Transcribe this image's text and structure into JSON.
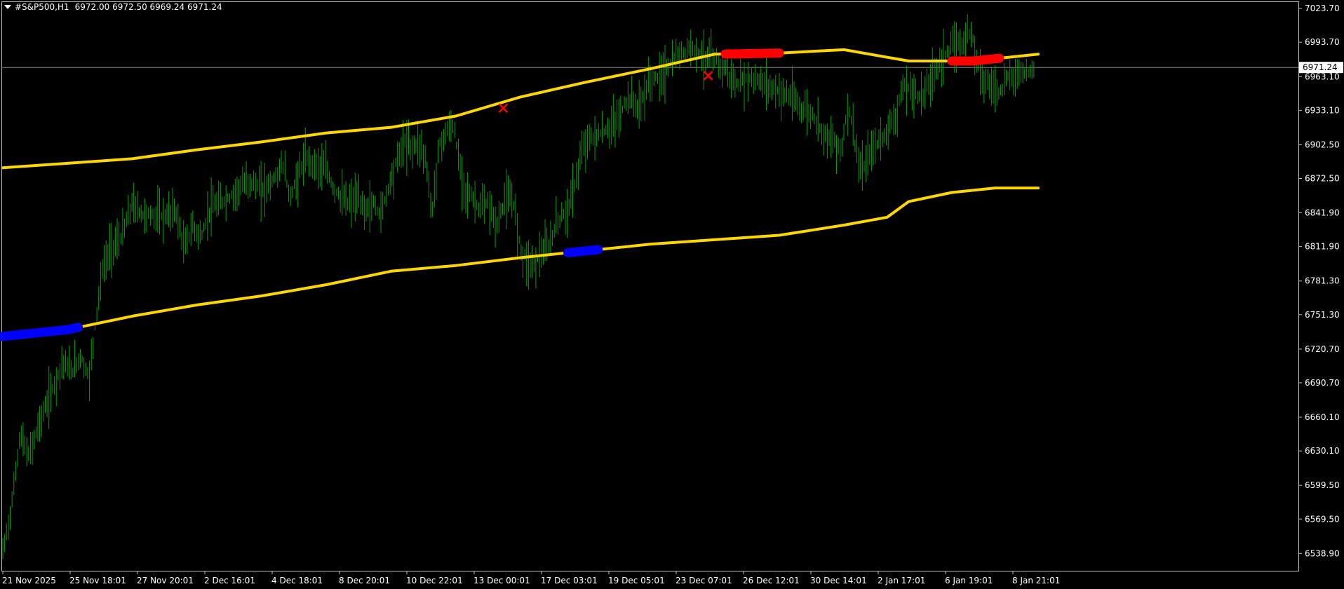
{
  "header": {
    "symbol_tf": "#S&P500,H1",
    "ohlc": "6972.00 6972.50 6969.24 6971.24"
  },
  "colors": {
    "background": "#000000",
    "grid_frame": "#c0c0c0",
    "candles": "#00a000",
    "band": "#ffd700",
    "signal_upper": "#ff0000",
    "signal_lower": "#0000ff",
    "price_line": "#808080",
    "label_text": "#ffffff",
    "current_price_box_bg": "#ffffff",
    "current_price_box_text": "#000000"
  },
  "chart_data": {
    "type": "line",
    "title": "#S&P500,H1",
    "ylim": [
      6523.5,
      7030.0
    ],
    "y_ticks": [
      "7023.70",
      "6993.70",
      "6963.10",
      "6933.10",
      "6902.50",
      "6872.50",
      "6841.90",
      "6811.90",
      "6781.30",
      "6751.30",
      "6720.70",
      "6690.70",
      "6660.10",
      "6630.10",
      "6599.50",
      "6569.50",
      "6538.90"
    ],
    "x_ticks": [
      "21 Nov 2025",
      "25 Nov 18:01",
      "27 Nov 20:01",
      "2 Dec 16:01",
      "4 Dec 18:01",
      "8 Dec 20:01",
      "10 Dec 22:01",
      "13 Dec 00:01",
      "17 Dec 03:01",
      "19 Dec 05:01",
      "23 Dec 07:01",
      "26 Dec 12:01",
      "30 Dec 14:01",
      "2 Jan 17:01",
      "6 Jan 19:01",
      "8 Jan 21:01"
    ],
    "current_price": "6971.24",
    "price_path": [
      [
        0,
        6540
      ],
      [
        0.4,
        6580
      ],
      [
        0.8,
        6645
      ],
      [
        1.2,
        6625
      ],
      [
        1.6,
        6650
      ],
      [
        2.0,
        6670
      ],
      [
        2.4,
        6690
      ],
      [
        2.8,
        6710
      ],
      [
        3.2,
        6700
      ],
      [
        3.6,
        6715
      ],
      [
        4.0,
        6695
      ],
      [
        4.3,
        6745
      ],
      [
        4.6,
        6790
      ],
      [
        5.0,
        6810
      ],
      [
        5.5,
        6820
      ],
      [
        6.0,
        6850
      ],
      [
        6.5,
        6840
      ],
      [
        7.0,
        6840
      ],
      [
        7.5,
        6838
      ],
      [
        8.0,
        6845
      ],
      [
        8.4,
        6810
      ],
      [
        8.8,
        6830
      ],
      [
        9.2,
        6820
      ],
      [
        9.6,
        6845
      ],
      [
        10.0,
        6850
      ],
      [
        10.5,
        6855
      ],
      [
        11.0,
        6865
      ],
      [
        11.5,
        6870
      ],
      [
        12.0,
        6862
      ],
      [
        12.5,
        6870
      ],
      [
        13.0,
        6885
      ],
      [
        13.3,
        6855
      ],
      [
        13.7,
        6875
      ],
      [
        14.0,
        6890
      ],
      [
        14.5,
        6885
      ],
      [
        15.0,
        6880
      ],
      [
        15.3,
        6865
      ],
      [
        15.7,
        6855
      ],
      [
        16.0,
        6850
      ],
      [
        16.4,
        6855
      ],
      [
        16.8,
        6845
      ],
      [
        17.2,
        6850
      ],
      [
        17.5,
        6840
      ],
      [
        17.8,
        6860
      ],
      [
        18.2,
        6885
      ],
      [
        18.6,
        6905
      ],
      [
        19.0,
        6900
      ],
      [
        19.3,
        6905
      ],
      [
        19.6,
        6890
      ],
      [
        19.9,
        6840
      ],
      [
        20.2,
        6900
      ],
      [
        20.6,
        6915
      ],
      [
        20.9,
        6920
      ],
      [
        21.2,
        6880
      ],
      [
        21.5,
        6860
      ],
      [
        21.8,
        6855
      ],
      [
        22.1,
        6845
      ],
      [
        22.5,
        6850
      ],
      [
        22.9,
        6830
      ],
      [
        23.3,
        6855
      ],
      [
        23.7,
        6850
      ],
      [
        24.0,
        6810
      ],
      [
        24.3,
        6800
      ],
      [
        24.6,
        6795
      ],
      [
        24.9,
        6805
      ],
      [
        25.3,
        6810
      ],
      [
        25.7,
        6835
      ],
      [
        26.0,
        6840
      ],
      [
        26.3,
        6850
      ],
      [
        26.6,
        6875
      ],
      [
        27.0,
        6905
      ],
      [
        27.5,
        6910
      ],
      [
        28.0,
        6915
      ],
      [
        28.5,
        6925
      ],
      [
        29.0,
        6945
      ],
      [
        29.5,
        6935
      ],
      [
        30.0,
        6960
      ],
      [
        30.5,
        6963
      ],
      [
        31.0,
        6975
      ],
      [
        31.5,
        6985
      ],
      [
        32.0,
        6990
      ],
      [
        32.5,
        6980
      ],
      [
        33.0,
        6978
      ],
      [
        33.5,
        6970
      ],
      [
        34.0,
        6955
      ],
      [
        34.5,
        6962
      ],
      [
        35.0,
        6960
      ],
      [
        35.5,
        6955
      ],
      [
        36.0,
        6950
      ],
      [
        36.5,
        6945
      ],
      [
        37.0,
        6935
      ],
      [
        37.5,
        6930
      ],
      [
        38.0,
        6915
      ],
      [
        38.5,
        6905
      ],
      [
        38.9,
        6900
      ],
      [
        39.2,
        6940
      ],
      [
        39.5,
        6905
      ],
      [
        39.8,
        6875
      ],
      [
        40.2,
        6895
      ],
      [
        40.6,
        6905
      ],
      [
        41.0,
        6915
      ],
      [
        41.4,
        6930
      ],
      [
        41.8,
        6955
      ],
      [
        42.2,
        6950
      ],
      [
        42.6,
        6945
      ],
      [
        43.0,
        6960
      ],
      [
        43.4,
        6975
      ],
      [
        43.8,
        6985
      ],
      [
        44.2,
        6992
      ],
      [
        44.6,
        6995
      ],
      [
        44.9,
        7005
      ],
      [
        45.2,
        6975
      ],
      [
        45.5,
        6960
      ],
      [
        45.8,
        6955
      ],
      [
        46.2,
        6950
      ],
      [
        46.6,
        6962
      ],
      [
        47.0,
        6965
      ],
      [
        47.4,
        6968
      ],
      [
        47.8,
        6970
      ]
    ],
    "series": [
      {
        "name": "",
        "points": [
          [
            0,
            6882
          ],
          [
            3,
            6886
          ],
          [
            6,
            6890
          ],
          [
            9,
            6898
          ],
          [
            12,
            6905
          ],
          [
            15,
            6913
          ],
          [
            18,
            6918
          ],
          [
            21,
            6928
          ],
          [
            24,
            6945
          ],
          [
            27,
            6958
          ],
          [
            30,
            6970
          ],
          [
            33,
            6983
          ],
          [
            36,
            6984
          ],
          [
            39,
            6987
          ],
          [
            42,
            6977
          ],
          [
            45,
            6977
          ],
          [
            48,
            6983
          ]
        ]
      },
      {
        "name": "",
        "points": [
          [
            0,
            6732
          ],
          [
            3,
            6738
          ],
          [
            6,
            6750
          ],
          [
            9,
            6760
          ],
          [
            12,
            6768
          ],
          [
            15,
            6778
          ],
          [
            18,
            6790
          ],
          [
            21,
            6795
          ],
          [
            24,
            6802
          ],
          [
            27,
            6808
          ],
          [
            30,
            6814
          ],
          [
            33,
            6818
          ],
          [
            36,
            6822
          ],
          [
            39,
            6831
          ],
          [
            41,
            6838
          ],
          [
            42,
            6852
          ],
          [
            44,
            6860
          ],
          [
            46,
            6864
          ],
          [
            48,
            6864
          ]
        ]
      }
    ],
    "signal_segments": [
      {
        "band": "lower",
        "x": [
          0,
          3.5
        ]
      },
      {
        "band": "lower",
        "x": [
          26.2,
          27.6
        ]
      },
      {
        "band": "upper",
        "x": [
          33.5,
          36.0
        ]
      },
      {
        "band": "upper",
        "x": [
          44.0,
          46.2
        ]
      }
    ],
    "cross_markers": [
      {
        "x": 23.2,
        "y": 6935
      },
      {
        "x": 32.7,
        "y": 6964
      }
    ],
    "grid": false,
    "legend": "none"
  }
}
